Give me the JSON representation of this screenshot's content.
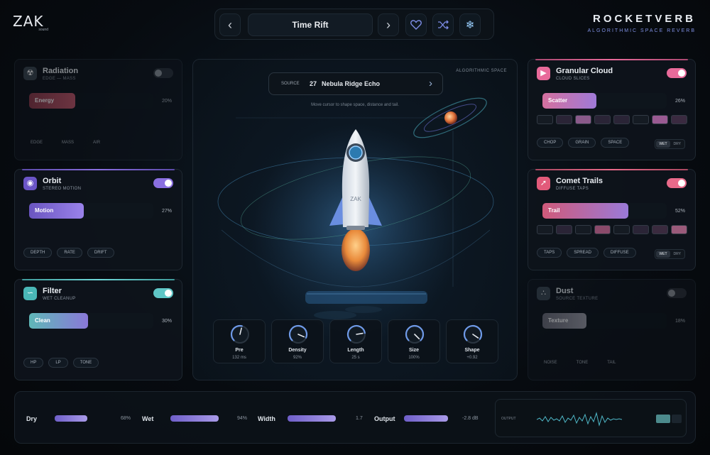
{
  "header": {
    "logo": "ZAK",
    "logo_sub": "sound",
    "preset_name": "Time Rift",
    "prev_icon": "chevron-left-icon",
    "next_icon": "chevron-right-icon",
    "icons": [
      "heart-icon",
      "shuffle-icon",
      "snowflake-icon"
    ],
    "brand_title": "ROCKETVERB",
    "brand_subtitle": "ALGORITHMIC SPACE REVERB"
  },
  "panels": {
    "radiation": {
      "title": "Radiation",
      "subtitle": "EDGE — MASS",
      "enabled": false,
      "bar_label": "Energy",
      "value": "20%",
      "level": 0.2,
      "chips": [
        "EDGE",
        "MASS",
        "AIR"
      ],
      "color": "#c0566a"
    },
    "orbit": {
      "title": "Orbit",
      "subtitle": "STEREO MOTION",
      "enabled": true,
      "bar_label": "Motion",
      "value": "27%",
      "level": 0.27,
      "chips": [
        "DEPTH",
        "RATE",
        "DRIFT"
      ],
      "color": "#8a6fe0"
    },
    "filter": {
      "title": "Filter",
      "subtitle": "WET CLEANUP",
      "enabled": true,
      "bar_label": "Clean",
      "value": "30%",
      "level": 0.3,
      "chips": [
        "HP",
        "LP",
        "TONE"
      ],
      "color": "#5fc6c6"
    },
    "granular": {
      "title": "Granular Cloud",
      "subtitle": "CLOUD SLICES",
      "enabled": true,
      "bar_label": "Scatter",
      "value": "26%",
      "level": 0.26,
      "chips": [
        "CHOP",
        "GRAIN",
        "SPACE"
      ],
      "wet": "WET",
      "dry": "DRY",
      "color": "#e86a9a"
    },
    "comet": {
      "title": "Comet Trails",
      "subtitle": "DIFFUSE TAPS",
      "enabled": true,
      "bar_label": "Trail",
      "value": "52%",
      "level": 0.52,
      "chips": [
        "TAPS",
        "SPREAD",
        "DIFFUSE"
      ],
      "wet": "WET",
      "dry": "DRY",
      "color": "#e86a8a"
    },
    "dust": {
      "title": "Dust",
      "subtitle": "SOURCE TEXTURE",
      "enabled": false,
      "bar_label": "Texture",
      "value": "18%",
      "level": 0.18,
      "chips": [
        "NOISE",
        "TONE",
        "TAIL"
      ],
      "color": "#9a9aa6"
    }
  },
  "center": {
    "tag": "ALGORITHMIC SPACE",
    "source_label": "SOURCE",
    "source_number": "27",
    "source_name": "Nebula Ridge Echo",
    "hint": "Move cursor to shape space, distance and tail.",
    "rocket_label": "ZAK"
  },
  "knobs": [
    {
      "name": "Pre",
      "value": "132 ms",
      "level": 0.55
    },
    {
      "name": "Density",
      "value": "92%",
      "level": 0.92
    },
    {
      "name": "Length",
      "value": "25 s",
      "level": 0.8
    },
    {
      "name": "Size",
      "value": "100%",
      "level": 1.0
    },
    {
      "name": "Shape",
      "value": "+0.92",
      "level": 0.96
    }
  ],
  "mix": {
    "dry": {
      "name": "Dry",
      "value": "68%",
      "level": 0.68
    },
    "wet": {
      "name": "Wet",
      "value": "94%",
      "level": 0.94
    },
    "width": {
      "name": "Width",
      "value": "1.7",
      "level": 0.85
    },
    "output": {
      "name": "Output",
      "value": "-2.8 dB",
      "level": 0.35
    }
  },
  "meter": {
    "label": "OUTPUT"
  }
}
